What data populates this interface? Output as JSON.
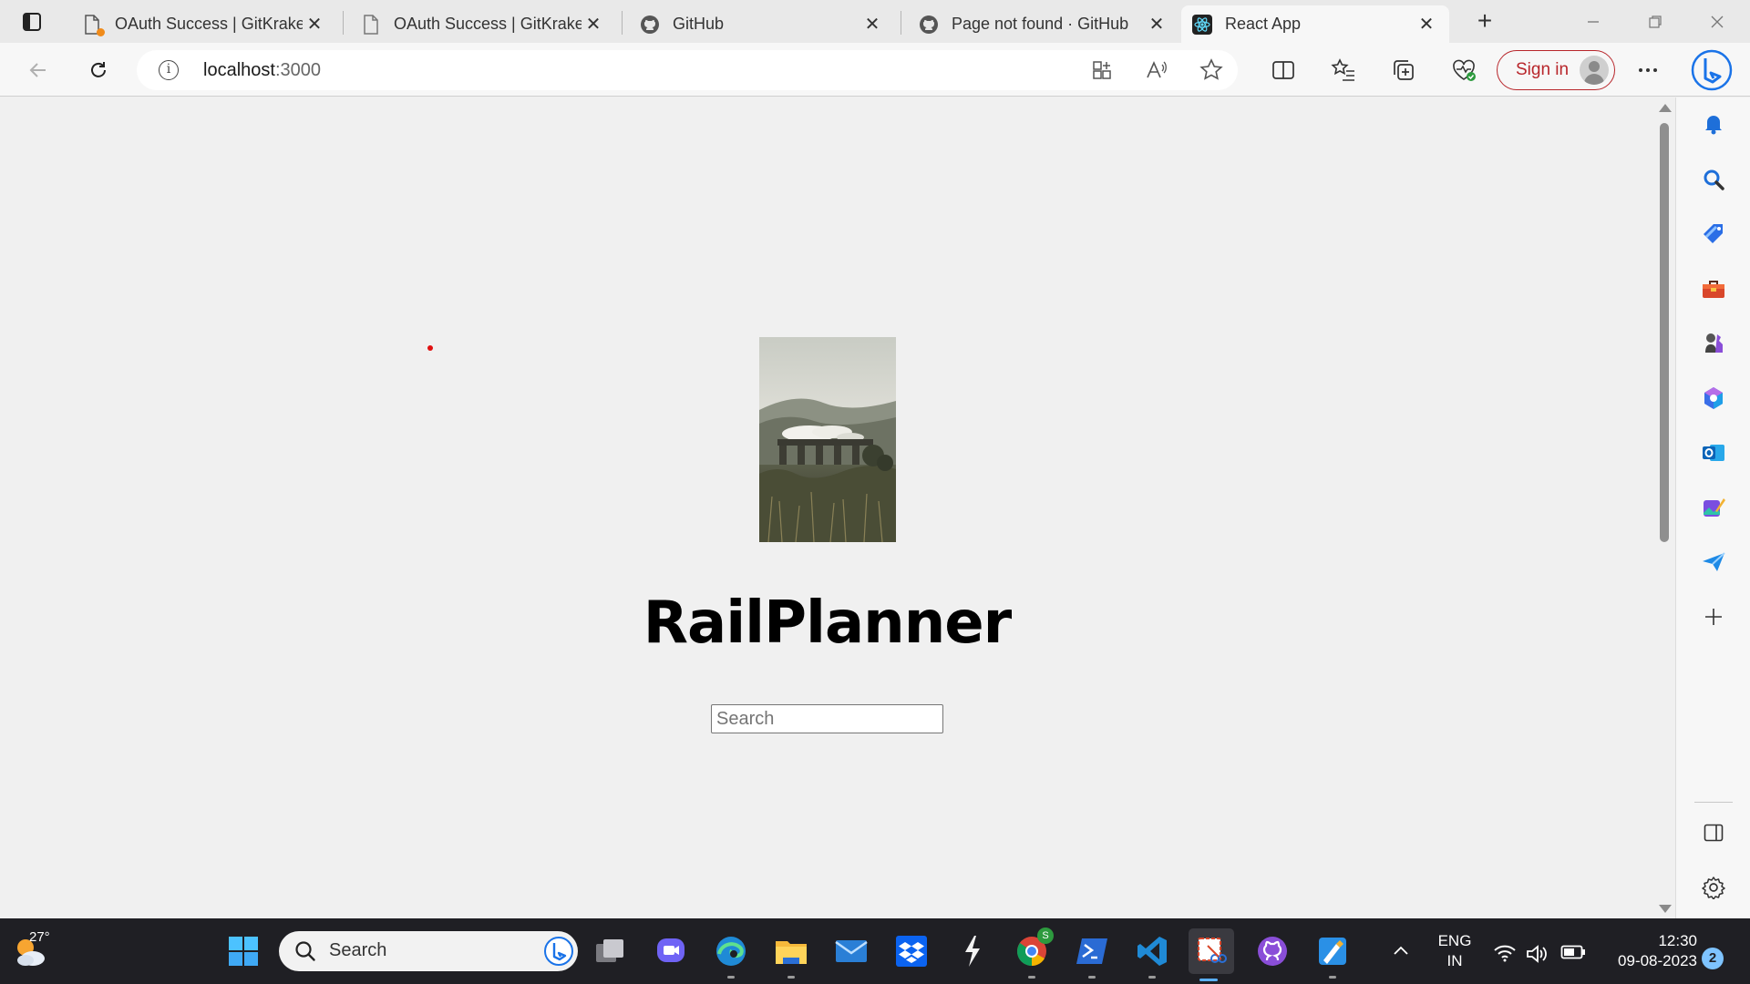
{
  "browser": {
    "tabs": [
      {
        "label": "OAuth Success | GitKraken",
        "icon": "page-icon"
      },
      {
        "label": "OAuth Success | GitKraken",
        "icon": "page-icon"
      },
      {
        "label": "GitHub",
        "icon": "github-icon"
      },
      {
        "label": "Page not found · GitHub",
        "icon": "github-icon"
      },
      {
        "label": "React App",
        "icon": "react-icon",
        "active": true
      }
    ],
    "address": {
      "host": "localhost",
      "port": ":3000"
    },
    "sign_in_label": "Sign in",
    "accent_color": "#b8262b"
  },
  "page": {
    "title": "RailPlanner",
    "search_placeholder": "Search",
    "hero_image": "steam train on viaduct in misty highlands"
  },
  "taskbar": {
    "weather_temp": "27°",
    "search_label": "Search",
    "lang_line1": "ENG",
    "lang_line2": "IN",
    "time": "12:30",
    "date": "09-08-2023",
    "notification_count": "2",
    "chrome_badge": "S"
  }
}
